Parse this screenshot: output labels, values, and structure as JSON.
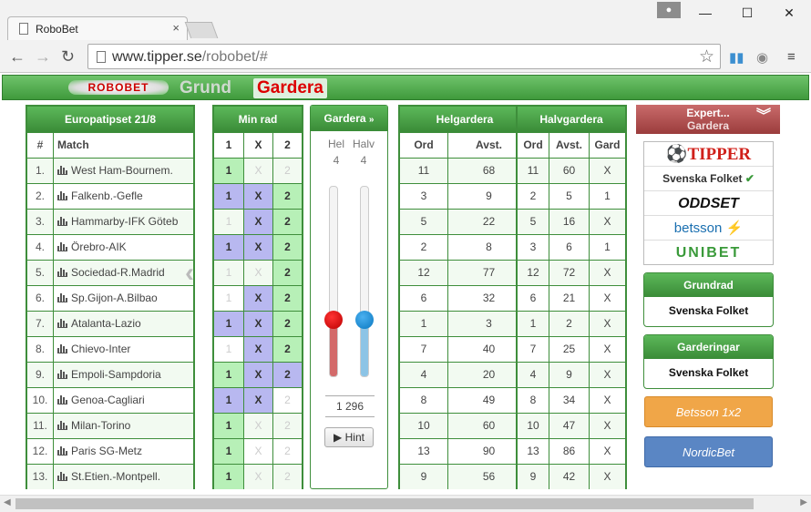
{
  "browser": {
    "tab_title": "RoboBet",
    "tab_close": "×",
    "url_host": "www.tipper.se",
    "url_path": "/robobet/#",
    "back_icon": "←",
    "forward_icon": "→",
    "reload_icon": "↻",
    "minimize": "—",
    "maximize": "☐",
    "close": "✕"
  },
  "nav": {
    "logo": "ROBOBET",
    "grund": "Grund",
    "gardera": "Gardera"
  },
  "europa": {
    "title": "Europatipset 21/8",
    "col_num": "#",
    "col_match": "Match",
    "rows": [
      {
        "n": "1.",
        "m": "West Ham-Bournem."
      },
      {
        "n": "2.",
        "m": "Falkenb.-Gefle"
      },
      {
        "n": "3.",
        "m": "Hammarby-IFK Göteb"
      },
      {
        "n": "4.",
        "m": "Örebro-AIK"
      },
      {
        "n": "5.",
        "m": "Sociedad-R.Madrid"
      },
      {
        "n": "6.",
        "m": "Sp.Gijon-A.Bilbao"
      },
      {
        "n": "7.",
        "m": "Atalanta-Lazio"
      },
      {
        "n": "8.",
        "m": "Chievo-Inter"
      },
      {
        "n": "9.",
        "m": "Empoli-Sampdoria"
      },
      {
        "n": "10.",
        "m": "Genoa-Cagliari"
      },
      {
        "n": "11.",
        "m": "Milan-Torino"
      },
      {
        "n": "12.",
        "m": "Paris SG-Metz"
      },
      {
        "n": "13.",
        "m": "St.Etien.-Montpell."
      }
    ]
  },
  "minrad": {
    "title": "Min rad",
    "h1": "1",
    "hx": "X",
    "h2": "2",
    "rows": [
      [
        "1",
        "X",
        "2"
      ],
      [
        "1",
        "X",
        "2"
      ],
      [
        "1",
        "X",
        "2"
      ],
      [
        "1",
        "X",
        "2"
      ],
      [
        "1",
        "X",
        "2"
      ],
      [
        "1",
        "X",
        "2"
      ],
      [
        "1",
        "X",
        "2"
      ],
      [
        "1",
        "X",
        "2"
      ],
      [
        "1",
        "X",
        "2"
      ],
      [
        "1",
        "X",
        "2"
      ],
      [
        "1",
        "X",
        "2"
      ],
      [
        "1",
        "X",
        "2"
      ],
      [
        "1",
        "X",
        "2"
      ]
    ]
  },
  "gardera": {
    "title": "Gardera",
    "hel_label": "Hel",
    "halv_label": "Halv",
    "hel_value": "4",
    "halv_value": "4",
    "hel_level": 0.3,
    "halv_level": 0.3,
    "total": "1 296",
    "hint": "▶ Hint"
  },
  "helgardera": {
    "title": "Helgardera",
    "col_ord": "Ord",
    "col_avst": "Avst.",
    "rows": [
      [
        "11",
        "68"
      ],
      [
        "3",
        "9"
      ],
      [
        "5",
        "22"
      ],
      [
        "2",
        "8"
      ],
      [
        "12",
        "77"
      ],
      [
        "6",
        "32"
      ],
      [
        "1",
        "3"
      ],
      [
        "7",
        "40"
      ],
      [
        "4",
        "20"
      ],
      [
        "8",
        "49"
      ],
      [
        "10",
        "60"
      ],
      [
        "13",
        "90"
      ],
      [
        "9",
        "56"
      ]
    ]
  },
  "halvgardera": {
    "title": "Halvgardera",
    "col_ord": "Ord",
    "col_avst": "Avst.",
    "col_gard": "Gard",
    "rows": [
      [
        "11",
        "60",
        "X"
      ],
      [
        "2",
        "5",
        "1"
      ],
      [
        "5",
        "16",
        "X"
      ],
      [
        "3",
        "6",
        "1"
      ],
      [
        "12",
        "72",
        "X"
      ],
      [
        "6",
        "21",
        "X"
      ],
      [
        "1",
        "2",
        "X"
      ],
      [
        "7",
        "25",
        "X"
      ],
      [
        "4",
        "9",
        "X"
      ],
      [
        "8",
        "34",
        "X"
      ],
      [
        "10",
        "47",
        "X"
      ],
      [
        "13",
        "86",
        "X"
      ],
      [
        "9",
        "42",
        "X"
      ]
    ]
  },
  "expert": {
    "title": "Expert...",
    "sub": "Gardera"
  },
  "sites": [
    "TIPPER",
    "Svenska Folket",
    "ODDSET",
    "betsson",
    "UNIBET"
  ],
  "grundrad": {
    "title": "Grundrad",
    "source": "Svenska Folket"
  },
  "garderingar": {
    "title": "Garderingar",
    "source": "Svenska Folket"
  },
  "betsson_btn": "Betsson 1x2",
  "nordic_btn": "NordicBet",
  "colors": {
    "green": "#3e8e3b",
    "blue_sel": "#b8b8f0",
    "green_sel": "#b7f0b7",
    "betsson": "#f0a648",
    "nordic": "#5a86c4"
  }
}
